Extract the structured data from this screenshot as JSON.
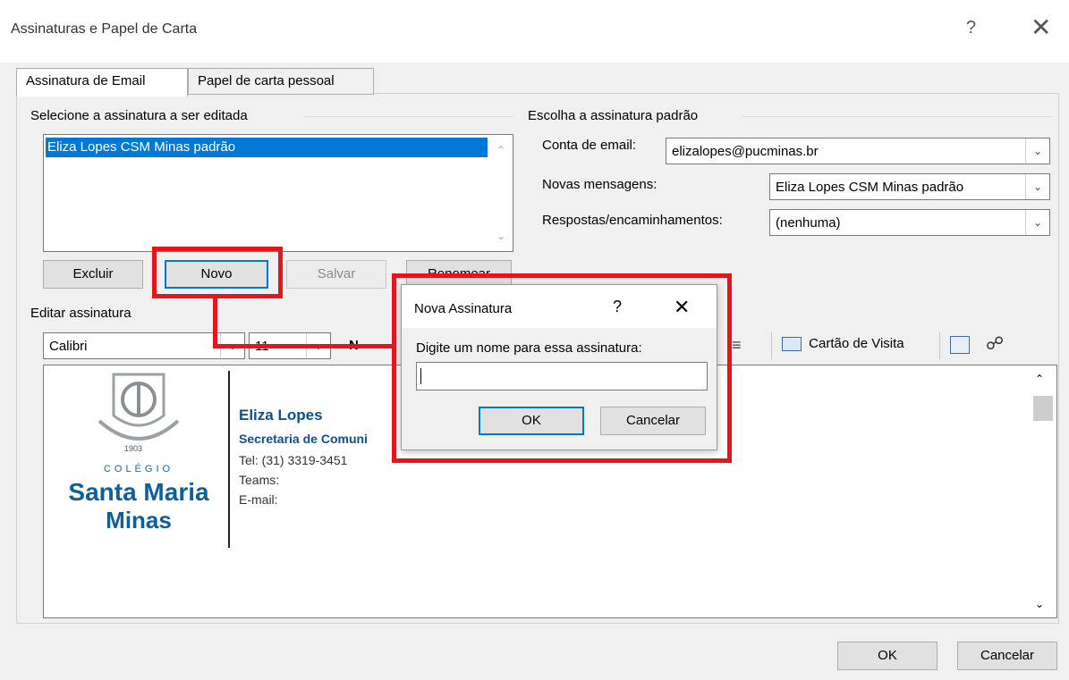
{
  "window": {
    "title": "Assinaturas e Papel de Carta",
    "help": "?",
    "close": "✕"
  },
  "tabs": [
    {
      "label": "Assinatura de Email"
    },
    {
      "label": "Papel de carta pessoal"
    }
  ],
  "left": {
    "group_label": "Selecione a assinatura a ser editada",
    "signatures": [
      "Eliza Lopes CSM Minas padrão"
    ],
    "buttons": {
      "delete": "Excluir",
      "new": "Novo",
      "save": "Salvar",
      "rename": "Renomear"
    }
  },
  "right": {
    "group_label": "Escolha a assinatura padrão",
    "account_label": "Conta de email:",
    "account_value": "elizalopes@pucminas.br",
    "new_messages_label": "Novas mensagens:",
    "new_messages_value": "Eliza Lopes CSM Minas padrão",
    "replies_label": "Respostas/encaminhamentos:",
    "replies_value": "(nenhuma)"
  },
  "editor": {
    "group_label": "Editar assinatura",
    "font": "Calibri",
    "size": "11",
    "bold_visible": "N",
    "business_card": "Cartão de Visita",
    "signature": {
      "logo_year": "1903",
      "logo_small": "COLÉGIO",
      "logo_line1": "Santa Maria",
      "logo_line2": "Minas",
      "name": "Eliza Lopes",
      "dept": "Secretaria de Comuni",
      "tel": "Tel: (31) 3319-3451",
      "teams": "Teams:",
      "email": "E-mail:"
    }
  },
  "dialog": {
    "title": "Nova Assinatura",
    "help": "?",
    "close": "✕",
    "prompt": "Digite um nome para essa assinatura:",
    "input_value": "",
    "ok": "OK",
    "cancel": "Cancelar"
  },
  "footer": {
    "ok": "OK",
    "cancel": "Cancelar"
  },
  "colors": {
    "highlight": "#e8141c",
    "selection": "#0078d7",
    "brand": "#0e4f8f"
  }
}
